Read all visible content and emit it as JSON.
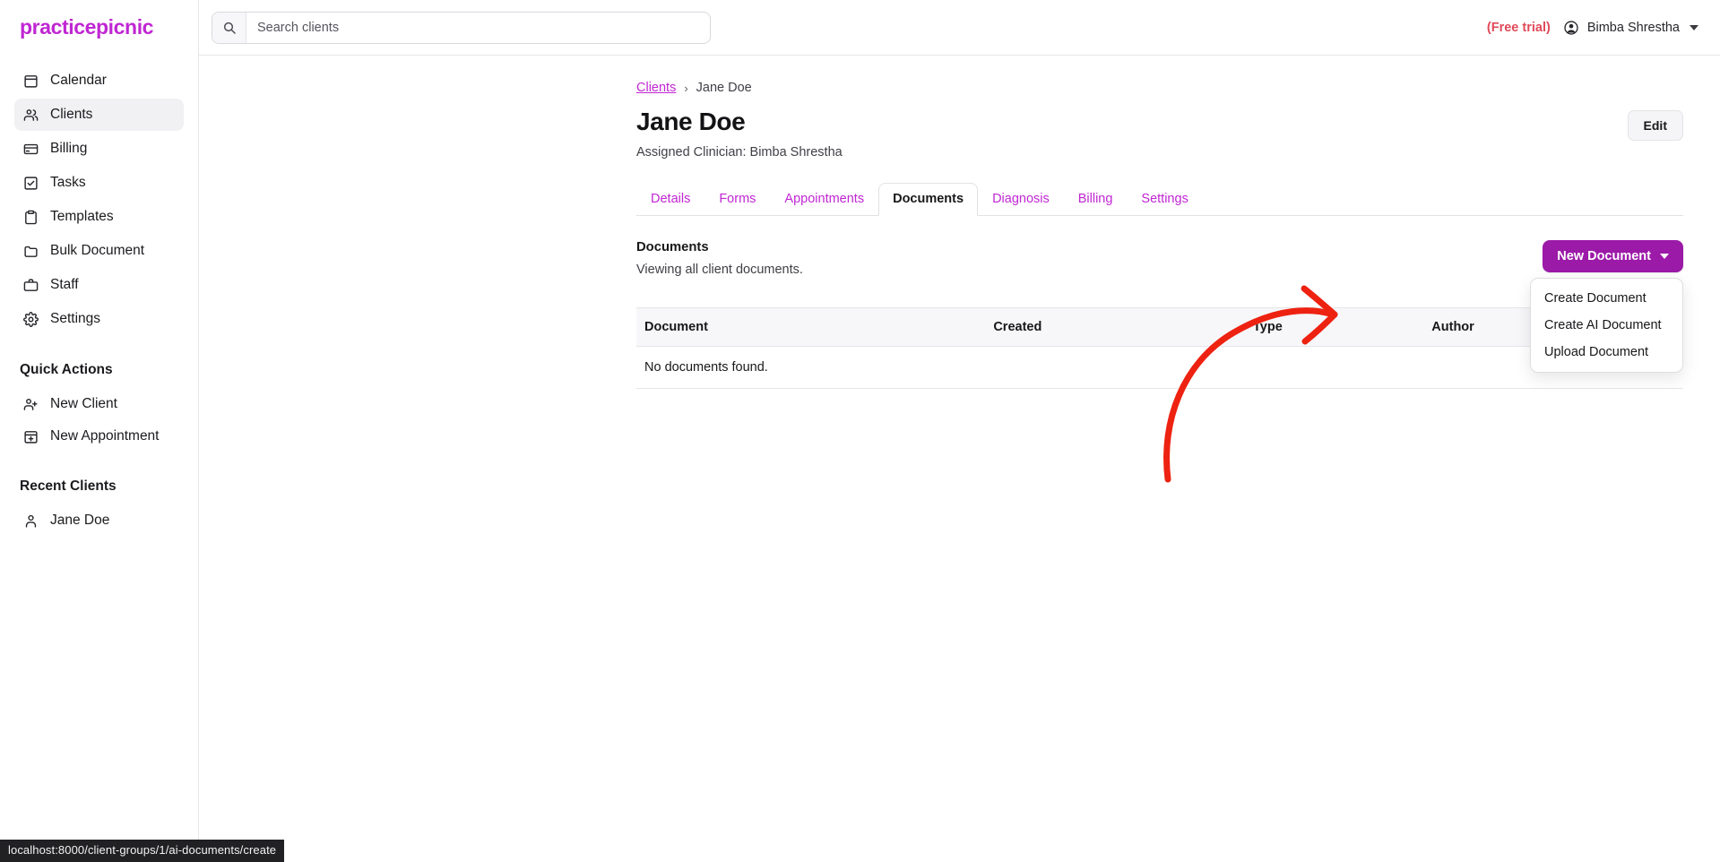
{
  "brand": {
    "logo_text": "practicepicnic",
    "accent": "#c026d3",
    "button_purple": "#9c1aa8",
    "trial_red": "#e04a59"
  },
  "sidebar": {
    "nav": [
      {
        "label": "Calendar",
        "icon": "calendar-icon",
        "active": false
      },
      {
        "label": "Clients",
        "icon": "users-icon",
        "active": true
      },
      {
        "label": "Billing",
        "icon": "card-icon",
        "active": false
      },
      {
        "label": "Tasks",
        "icon": "checkbox-icon",
        "active": false
      },
      {
        "label": "Templates",
        "icon": "clipboard-icon",
        "active": false
      },
      {
        "label": "Bulk Document",
        "icon": "folder-icon",
        "active": false
      },
      {
        "label": "Staff",
        "icon": "briefcase-icon",
        "active": false
      },
      {
        "label": "Settings",
        "icon": "gear-icon",
        "active": false
      }
    ],
    "quick_actions_title": "Quick Actions",
    "quick_actions": [
      {
        "label": "New Client",
        "icon": "user-plus-icon"
      },
      {
        "label": "New Appointment",
        "icon": "calendar-plus-icon"
      }
    ],
    "recent_clients_title": "Recent Clients",
    "recent_clients": [
      {
        "label": "Jane Doe",
        "icon": "user-icon"
      }
    ]
  },
  "topbar": {
    "search_placeholder": "Search clients",
    "search_value": "",
    "trial_label": "(Free trial)",
    "user_name": "Bimba Shrestha"
  },
  "breadcrumb": {
    "parent": "Clients",
    "separator": "›",
    "current": "Jane Doe"
  },
  "client": {
    "name": "Jane Doe",
    "assigned_clinician": "Assigned Clinician: Bimba Shrestha",
    "edit_label": "Edit"
  },
  "tabs": [
    {
      "label": "Details",
      "active": false
    },
    {
      "label": "Forms",
      "active": false
    },
    {
      "label": "Appointments",
      "active": false
    },
    {
      "label": "Documents",
      "active": true
    },
    {
      "label": "Diagnosis",
      "active": false
    },
    {
      "label": "Billing",
      "active": false
    },
    {
      "label": "Settings",
      "active": false
    }
  ],
  "documents": {
    "heading": "Documents",
    "subheading": "Viewing all client documents.",
    "new_document_label": "New Document",
    "dropdown_items": [
      "Create Document",
      "Create AI Document",
      "Upload Document"
    ],
    "table": {
      "columns": [
        "Document",
        "Created",
        "Type",
        "Author"
      ],
      "empty_message": "No documents found.",
      "rows": []
    }
  },
  "annotation": {
    "arrow_color": "#ee2211",
    "points_to": "Create AI Document"
  },
  "statusbar": {
    "url": "localhost:8000/client-groups/1/ai-documents/create"
  }
}
